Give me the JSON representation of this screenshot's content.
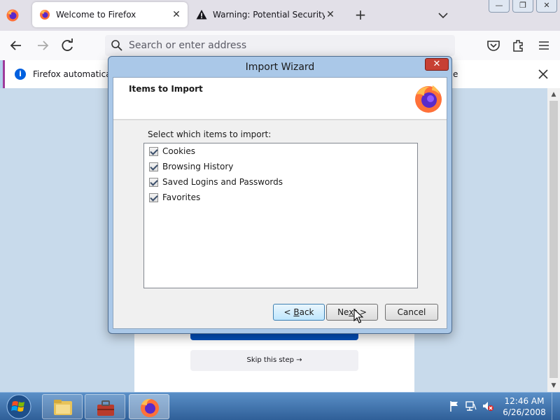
{
  "browser": {
    "tabs": [
      {
        "label": "Welcome to Firefox",
        "active": true,
        "icon": "firefox-icon"
      },
      {
        "label": "Warning: Potential Security Risk",
        "active": false,
        "icon": "warning-icon"
      }
    ],
    "tab_close": "✕",
    "new_tab": "+",
    "window_buttons": {
      "minimize": "—",
      "maximize": "❐",
      "close": "✕"
    },
    "urlbar_placeholder": "Search or enter address",
    "notification": {
      "text_start": "Firefox automatically",
      "text_end": "e"
    }
  },
  "content": {
    "skip_button": "Skip this step →"
  },
  "dialog": {
    "title": "Import Wizard",
    "close": "✕",
    "header": "Items to Import",
    "select_label": "Select which items to import:",
    "items": [
      {
        "label": "Cookies",
        "checked": true
      },
      {
        "label": "Browsing History",
        "checked": true
      },
      {
        "label": "Saved Logins and Passwords",
        "checked": true
      },
      {
        "label": "Favorites",
        "checked": true
      }
    ],
    "buttons": {
      "back_pre": "< ",
      "back_ul": "B",
      "back_post": "ack",
      "next_pre": "Ne",
      "next_ul": "x",
      "next_post": "t >",
      "cancel": "Cancel"
    }
  },
  "taskbar": {
    "time": "12:46 AM",
    "date": "6/26/2008",
    "items": [
      "explorer-icon",
      "toolbox-icon",
      "firefox-icon"
    ]
  },
  "colors": {
    "accent": "#0060df",
    "brand_bar": "#0250bb",
    "dialog_frame": "#aac8e8",
    "taskbar": "#3a6ea5"
  }
}
